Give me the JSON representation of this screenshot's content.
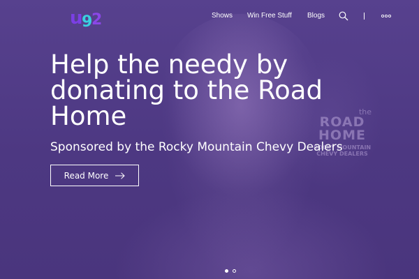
{
  "brand": {
    "logo_text": "u92",
    "logo_colors": {
      "u": "#7b3fe4",
      "nine": "#3ad0e0",
      "two": "#8b47e8"
    }
  },
  "nav": {
    "items": [
      {
        "label": "Shows"
      },
      {
        "label": "Win Free Stuff"
      },
      {
        "label": "Blogs"
      }
    ],
    "search_icon": "search-icon",
    "more_icon": "more-dots-icon"
  },
  "hero": {
    "headline": "Help the needy by donating to the Road Home",
    "subheadline": "Sponsored by the Rocky Mountain Chevy Dealers",
    "cta_label": "Read More",
    "cta_icon": "arrow-right-icon",
    "background_color": "#4f3a84"
  },
  "sign": {
    "the": "the",
    "road": "ROAD",
    "home": "HOME",
    "sponsor_line1": "ROCKY MOUNTAIN",
    "sponsor_line2": "CHEVY DEALERS"
  },
  "slider": {
    "total": 2,
    "active_index": 0
  }
}
